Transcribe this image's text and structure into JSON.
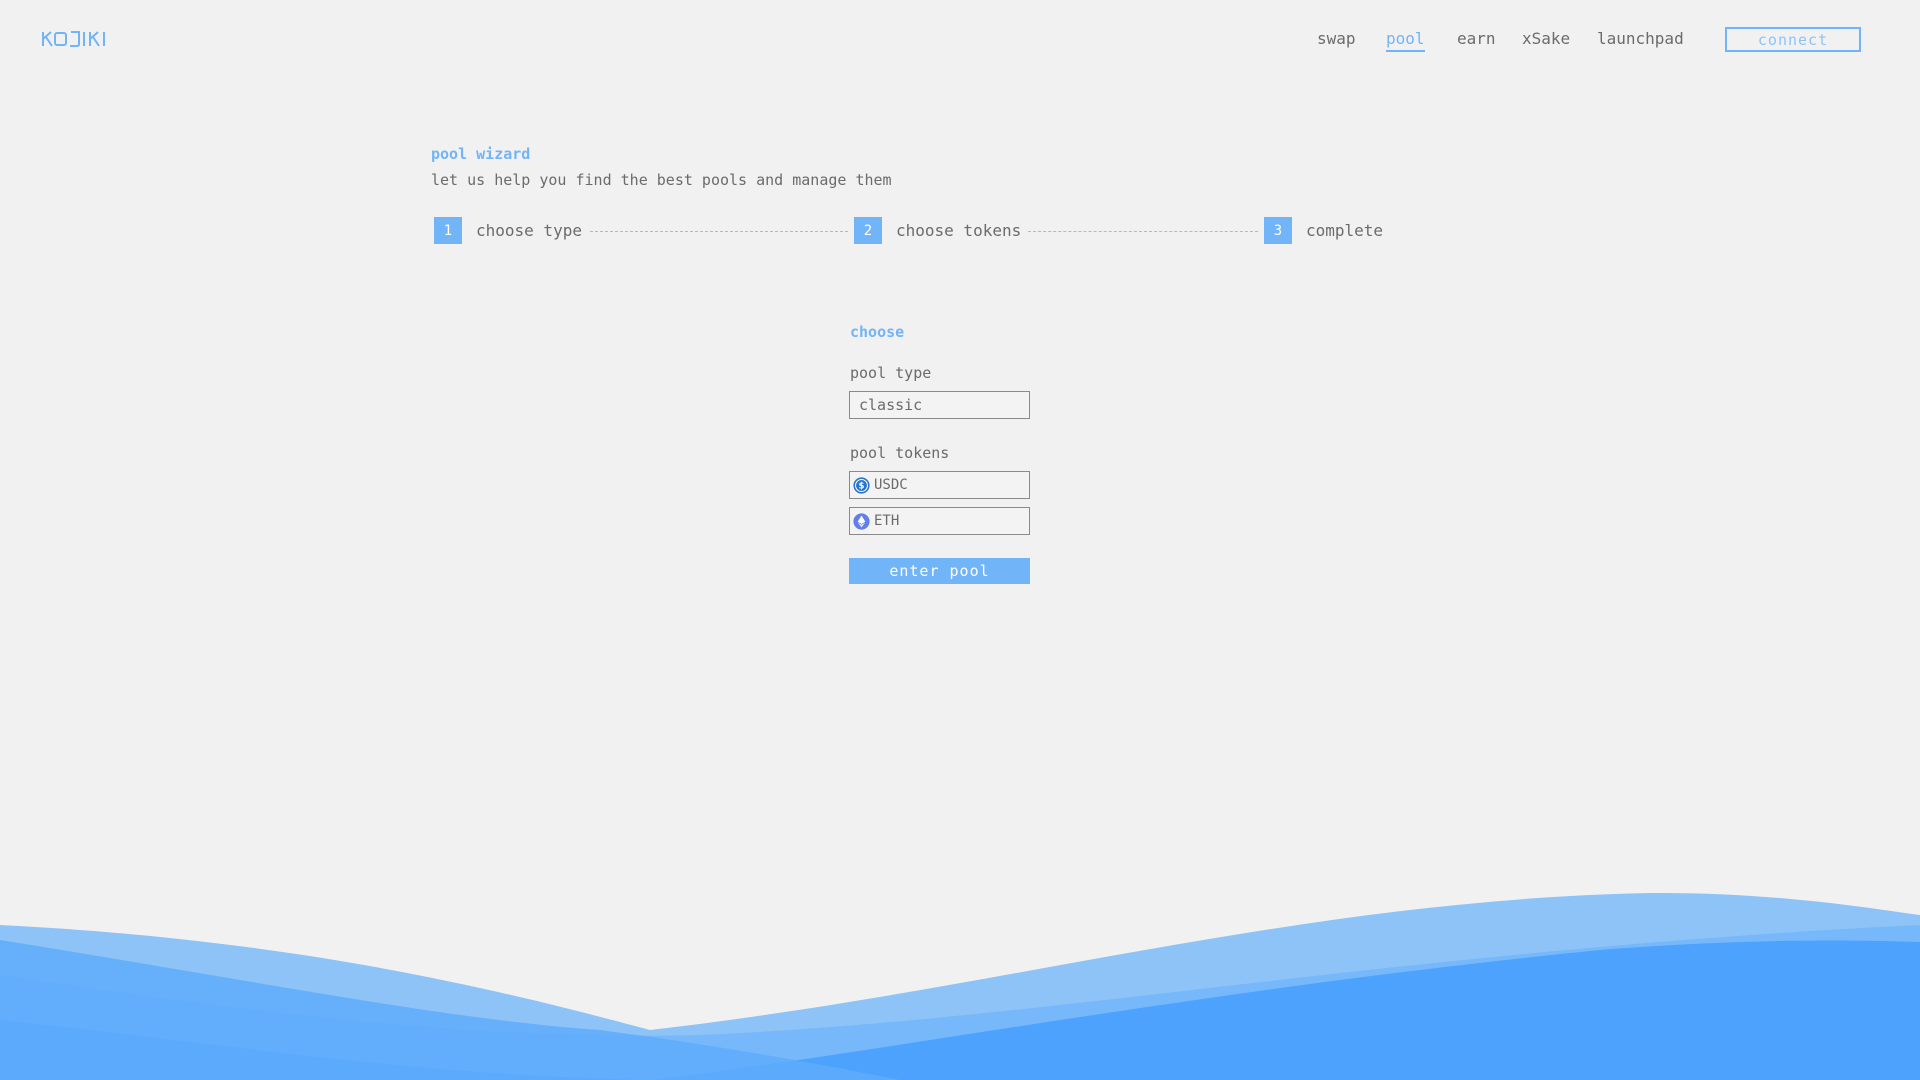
{
  "brand": {
    "logo_text": "KOJIKI"
  },
  "nav": {
    "items": [
      {
        "label": "swap",
        "active": false
      },
      {
        "label": "pool",
        "active": true
      },
      {
        "label": "earn",
        "active": false
      },
      {
        "label": "xSake",
        "active": false
      },
      {
        "label": "launchpad",
        "active": false
      }
    ],
    "connect_label": "connect"
  },
  "wizard": {
    "title": "pool wizard",
    "subtitle": "let us help you find the best pools and manage them",
    "steps": [
      {
        "number": "1",
        "label": "choose type"
      },
      {
        "number": "2",
        "label": "choose tokens"
      },
      {
        "number": "3",
        "label": "complete"
      }
    ]
  },
  "form": {
    "title": "choose",
    "pool_type_label": "pool type",
    "pool_type_value": "classic",
    "pool_tokens_label": "pool tokens",
    "tokens": [
      {
        "symbol": "USDC",
        "icon": "usdc-icon"
      },
      {
        "symbol": "ETH",
        "icon": "eth-icon"
      }
    ],
    "submit_label": "enter pool"
  },
  "colors": {
    "accent": "#72b4f8",
    "background": "#f1f1f1",
    "wave_light": "#8ec3f7",
    "wave_mid": "#6aaefb",
    "wave_dark": "#4ca2fd"
  }
}
